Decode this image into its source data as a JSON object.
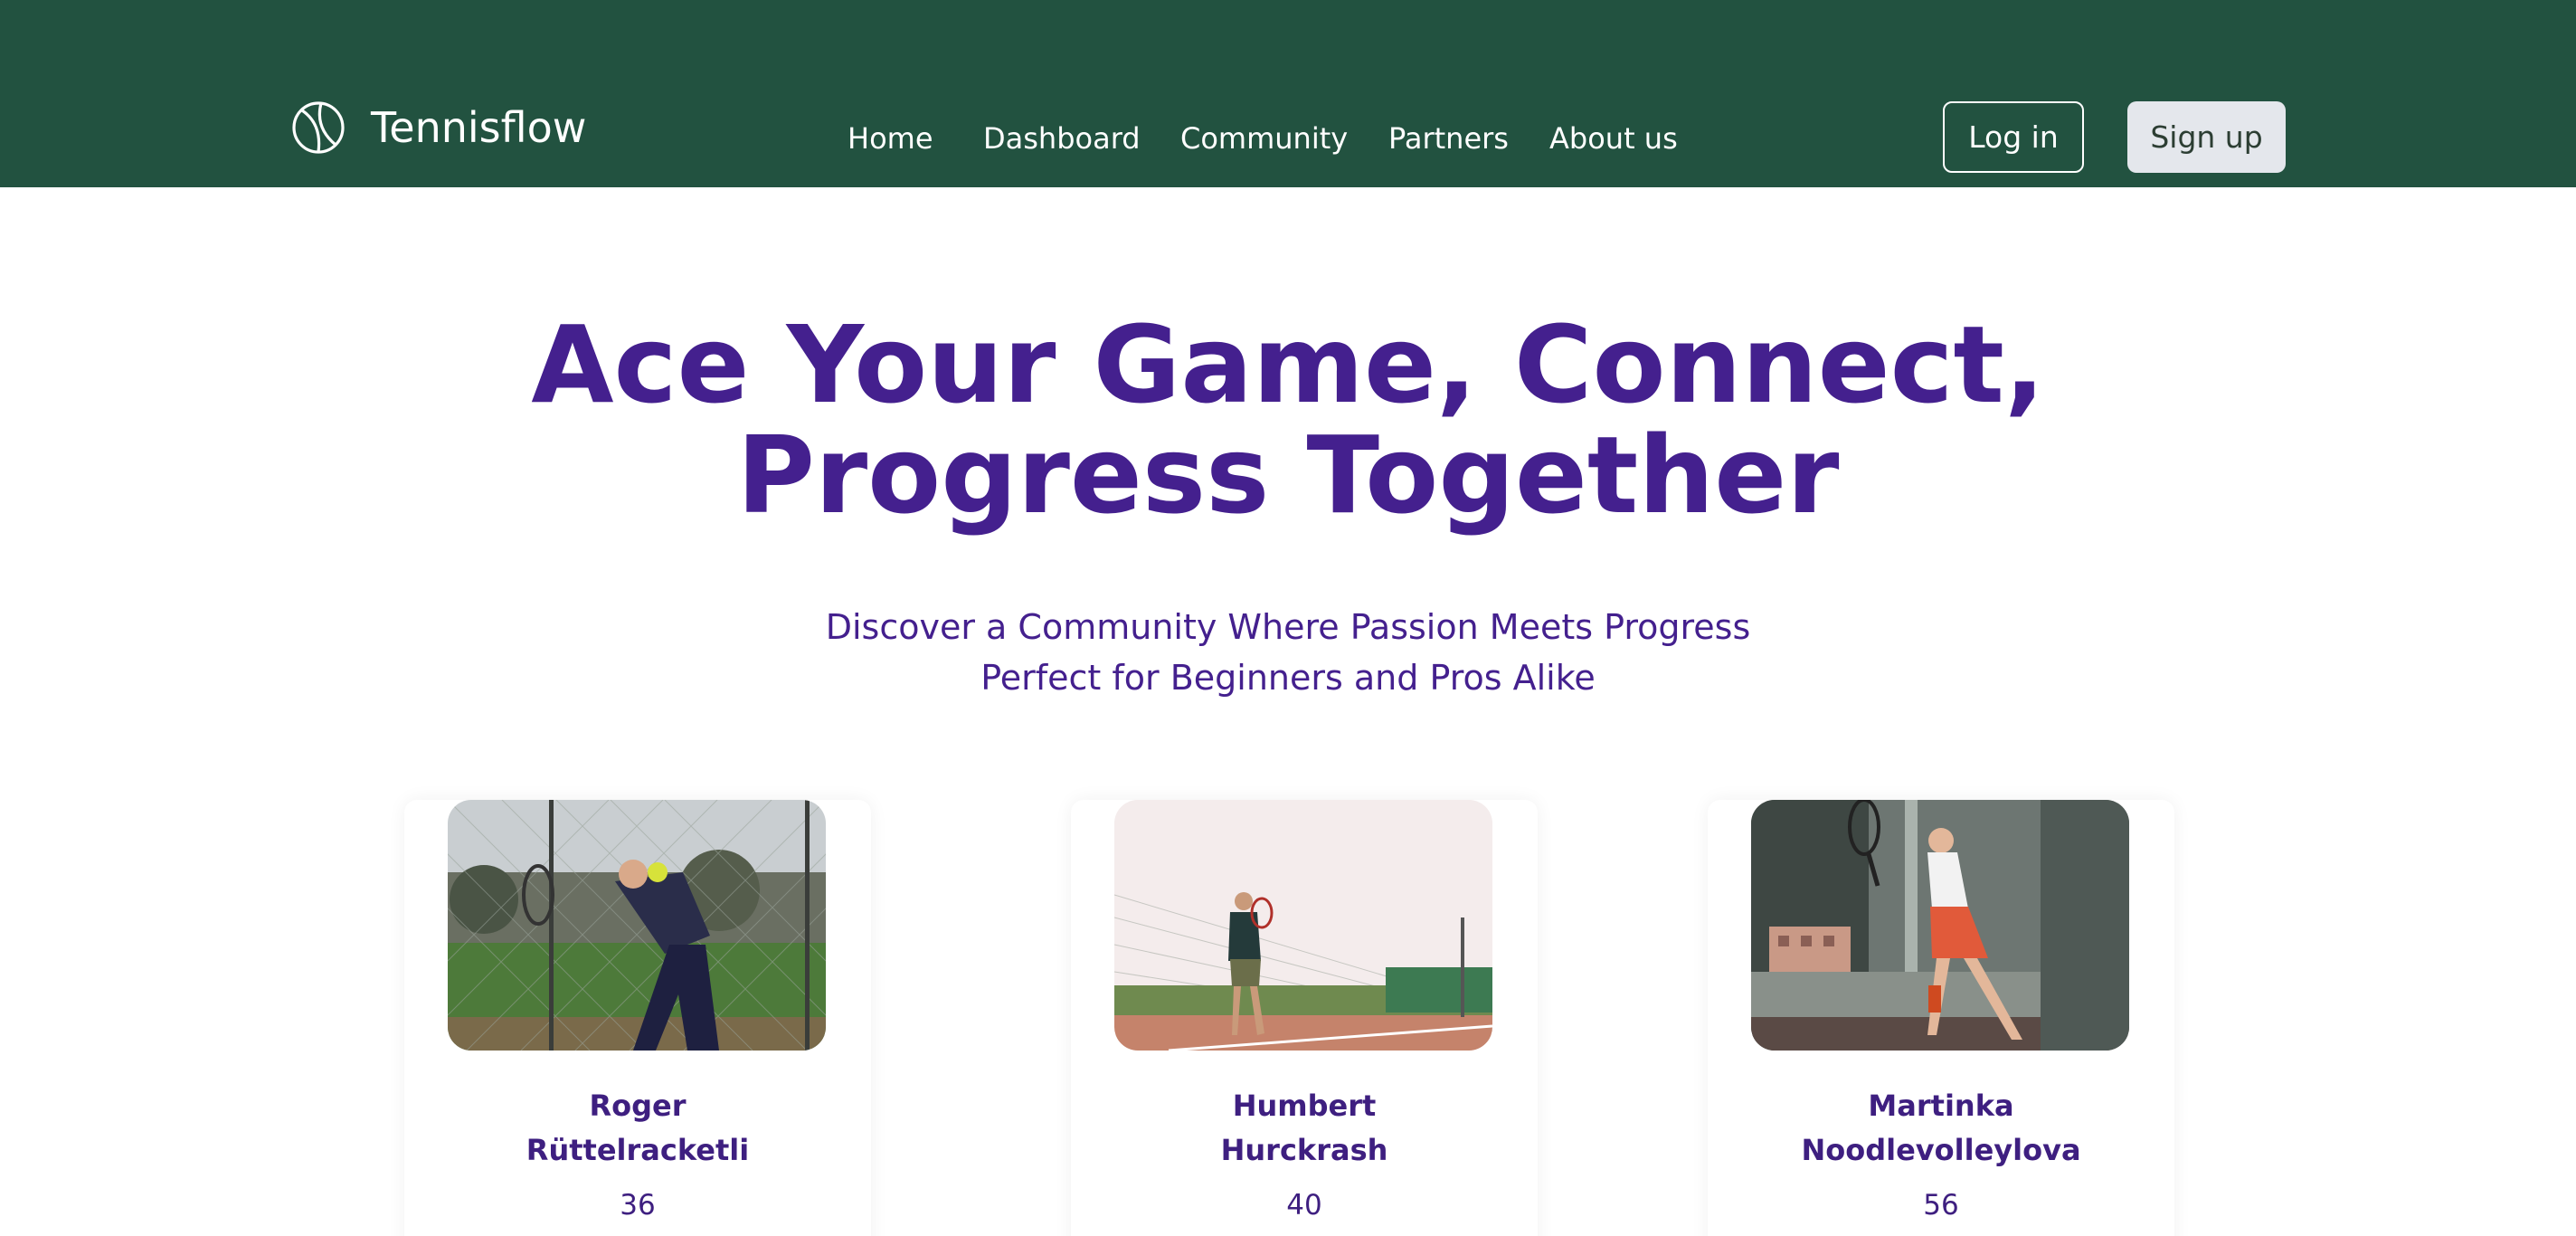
{
  "brand": {
    "name": "Tennisflow",
    "icon": "tennis-ball-icon"
  },
  "nav": {
    "links": [
      "Home",
      "Dashboard",
      "Community",
      "Partners",
      "About us"
    ],
    "login_label": "Log in",
    "signup_label": "Sign up"
  },
  "hero": {
    "title_line1": "Ace Your Game, Connect,",
    "title_line2": "Progress Together",
    "subtitle_line1": "Discover a Community Where Passion Meets Progress",
    "subtitle_line2": "Perfect for Beginners and Pros Alike"
  },
  "players": [
    {
      "first_name": "Roger",
      "last_name": "Rüttelracketli",
      "age": "36"
    },
    {
      "first_name": "Humbert",
      "last_name": "Hurckrash",
      "age": "40"
    },
    {
      "first_name": "Martinka",
      "last_name": "Noodlevolleylova",
      "age": "56"
    }
  ],
  "colors": {
    "navbar": "#225240",
    "heading": "#44208e",
    "signup_bg": "#e4e7ec"
  }
}
